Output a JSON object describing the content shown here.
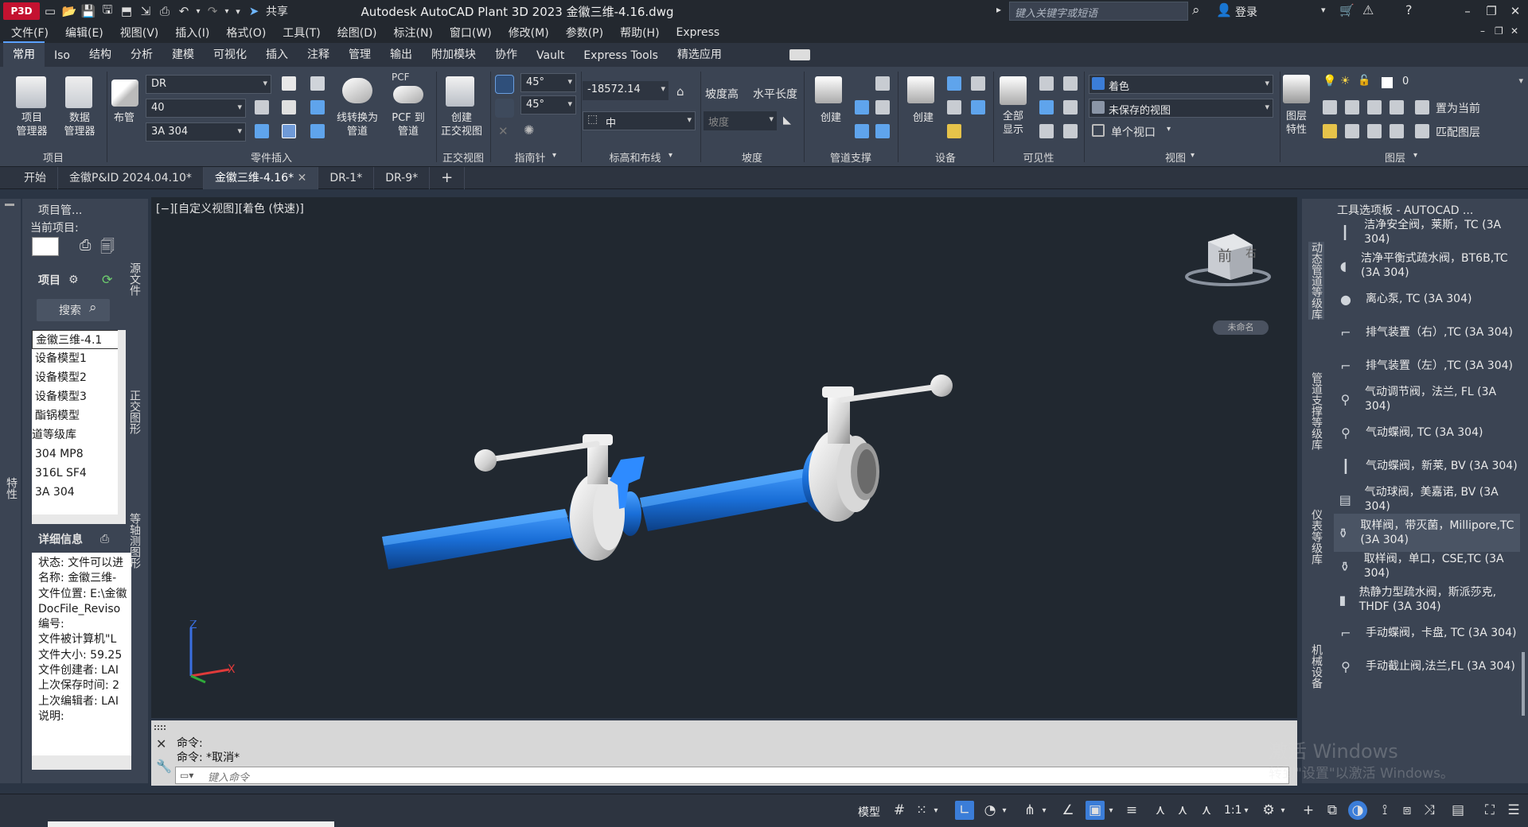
{
  "titlebar": {
    "app_button": "P3D",
    "share_label": "共享",
    "title": "Autodesk AutoCAD Plant 3D 2023    金徽三维-4.16.dwg",
    "search_placeholder": "键入关键字或短语",
    "login_label": "登录"
  },
  "menubar": [
    "文件(F)",
    "编辑(E)",
    "视图(V)",
    "插入(I)",
    "格式(O)",
    "工具(T)",
    "绘图(D)",
    "标注(N)",
    "窗口(W)",
    "修改(M)",
    "参数(P)",
    "帮助(H)",
    "Express"
  ],
  "ribbon_tabs": [
    "常用",
    "Iso",
    "结构",
    "分析",
    "建模",
    "可视化",
    "插入",
    "注释",
    "管理",
    "输出",
    "附加模块",
    "协作",
    "Vault",
    "Express Tools",
    "精选应用"
  ],
  "ribbon": {
    "project_manager": "项目\n管理器",
    "data_manager": "数据\n管理器",
    "routing": "布管",
    "spec_combo": "DR",
    "size_combo": "40",
    "material_combo": "3A 304",
    "line_to_pipe": "线转换为\n管道",
    "pcf_top": "PCF",
    "pcf_to_pipe": "PCF 到\n管道",
    "create_ortho": "创建\n正交视图",
    "angle1": "45°",
    "angle2": "45°",
    "elevation": "-18572.14",
    "center_combo": "中",
    "slope_elev": "坡度高",
    "horiz_len": "水平长度",
    "slope_placeholder": "坡度",
    "support_create": "创建",
    "equip_create": "创建",
    "show_all": "全部\n显示",
    "visual_style": "着色",
    "saved_view": "未保存的视图",
    "single_viewport": "单个视口",
    "layer_props": "图层\n特性",
    "layer_name": "0",
    "set_current": "置为当前",
    "match_layer": "匹配图层",
    "panels": [
      "项目",
      "零件插入",
      "正交视图",
      "指南针",
      "标高和布线",
      "坡度",
      "管道支撑",
      "设备",
      "可见性",
      "视图",
      "图层"
    ]
  },
  "doc_tabs": [
    "开始",
    "金徽P&ID 2024.04.10*",
    "金徽三维-4.16*",
    "DR-1*",
    "DR-9*"
  ],
  "project_panel": {
    "header": "项目管...",
    "current_project": "当前项目:",
    "tab_project": "项目",
    "search": "搜索",
    "tree": [
      "金徽三维-4.1",
      "设备模型1",
      "设备模型2",
      "设备模型3",
      "酯锅模型",
      "道等级库",
      "304 MP8",
      "316L SF4",
      "3A 304"
    ],
    "details_header": "详细信息",
    "details": [
      "状态: 文件可以进",
      "名称: 金徽三维-",
      "文件位置: E:\\金徽",
      "DocFile_Reviso",
      "编号:",
      "文件被计算机\"L",
      "文件大小: 59.25",
      "文件创建者: LAI",
      "上次保存时间: 2",
      "上次编辑者: LAI",
      "说明:"
    ],
    "side_tabs": [
      "源文件",
      "正交图形",
      "等轴测图形"
    ],
    "left_strip": "特性"
  },
  "viewport": {
    "label": "[−][自定义视图][着色 (快速)]",
    "viewcube_face": "前",
    "viewcube_side": "右",
    "unnamed": "未命名"
  },
  "command": {
    "line1": "命令:",
    "line2": "命令: *取消*",
    "placeholder": "键入命令"
  },
  "palette": {
    "header": "工具选项板 - AUTOCAD ...",
    "side_tabs": [
      "动态管道等级库",
      "管道支撑等级库",
      "仪表等级库",
      "机械设备"
    ],
    "items": [
      "洁净安全阀，莱斯，TC (3A 304)",
      "洁净平衡式疏水阀，BT6B,TC (3A 304)",
      "离心泵, TC (3A 304)",
      "排气装置（右）,TC (3A 304)",
      "排气装置（左）,TC (3A 304)",
      "气动调节阀，法兰, FL (3A 304)",
      "气动蝶阀, TC (3A 304)",
      "气动蝶阀，新莱, BV (3A 304)",
      "气动球阀，美嘉诺, BV (3A 304)",
      "取样阀，带灭菌，Millipore,TC (3A 304)",
      "取样阀，单口，CSE,TC (3A 304)",
      "热静力型疏水阀，斯派莎克, THDF (3A 304)",
      "手动蝶阀，卡盘, TC (3A 304)",
      "手动截止阀,法兰,FL (3A 304)"
    ]
  },
  "status": {
    "model": "模型",
    "scale": "1:1"
  },
  "watermark": {
    "line1": "激活 Windows",
    "line2": "转到\"设置\"以激活 Windows。"
  },
  "colors": {
    "pipe_blue": "#1a6fd8",
    "valve_gray": "#d4d4d4",
    "viewport_bg": "#212830",
    "app_red": "#c41230"
  }
}
